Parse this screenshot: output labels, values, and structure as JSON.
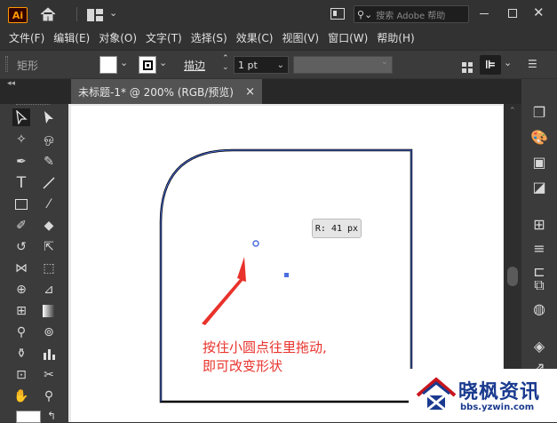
{
  "app": {
    "logo": "Ai"
  },
  "titlebar": {
    "search_placeholder": "搜索 Adobe 帮助",
    "icons": [
      "home-icon",
      "layout-icon",
      "panel-icon",
      "search-icon",
      "minimize-icon",
      "restore-icon",
      "close-icon"
    ]
  },
  "menu": [
    "文件(F)",
    "编辑(E)",
    "对象(O)",
    "文字(T)",
    "选择(S)",
    "效果(C)",
    "视图(V)",
    "窗口(W)",
    "帮助(H)"
  ],
  "control": {
    "object_label": "矩形",
    "stroke_label": "描边",
    "stroke_value": "1 pt",
    "fill_color": "#ffffff"
  },
  "tab": {
    "title": "未标题-1* @ 200% (RGB/预览)",
    "close": "×"
  },
  "canvas": {
    "tooltip": "R: 41 px",
    "annotation_line1": "按住小圆点往里拖动,",
    "annotation_line2": "即可改变形状",
    "annotation_color": "#e8322b",
    "shape_stroke": "#000000",
    "selection_color": "#4b6fe0"
  },
  "watermark": {
    "name": "晓枫资讯",
    "url": "bbs.yzwin.com"
  }
}
